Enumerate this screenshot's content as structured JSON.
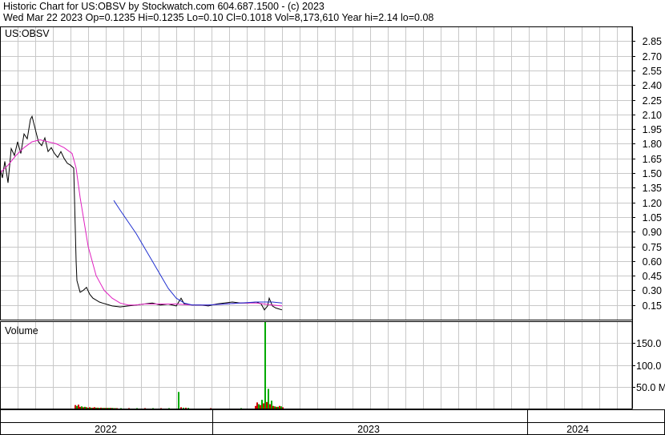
{
  "header": {
    "title_line": "Historic Chart for US:OBSV by Stockwatch.com 604.687.1500 - (c) 2023",
    "quote_line": "Wed Mar 22 2023   Op=0.1235   Hi=0.1235   Lo=0.10   Cl=0.1018   Vol=8,173,610   Year hi=2.14   lo=0.08"
  },
  "colors": {
    "price": "#000000",
    "ma_short": "#e020c0",
    "ma_long": "#2030d0",
    "vol_up": "#00aa00",
    "vol_down": "#cc0000",
    "grid": "#c8c8c8"
  },
  "chart_data": [
    {
      "type": "line",
      "panel_label": "US:OBSV",
      "ylim": [
        0.0,
        3.0
      ],
      "y_ticks": [
        "2.85",
        "2.70",
        "2.55",
        "2.40",
        "2.25",
        "2.10",
        "1.95",
        "1.80",
        "1.65",
        "1.50",
        "1.35",
        "1.20",
        "1.05",
        "0.90",
        "0.75",
        "0.60",
        "0.45",
        "0.30",
        "0.15"
      ],
      "x_labels": [
        "2022",
        "2023",
        "2024"
      ],
      "series": [
        {
          "key": "price",
          "x": [
            0,
            3,
            6,
            10,
            14,
            18,
            22,
            26,
            30,
            34,
            38,
            40,
            44,
            48,
            52,
            56,
            60,
            64,
            68,
            72,
            76,
            80,
            84,
            88,
            92,
            95,
            96,
            100,
            104,
            108,
            112,
            116,
            120,
            124,
            128,
            132,
            140,
            150,
            160,
            170,
            180,
            190,
            200,
            210,
            220,
            226,
            230,
            240,
            250,
            260,
            270,
            280,
            290,
            300,
            310,
            320,
            326,
            330,
            334,
            336,
            340,
            344,
            348,
            352
          ],
          "values": [
            1.55,
            1.45,
            1.62,
            1.4,
            1.75,
            1.68,
            1.82,
            1.7,
            1.9,
            1.85,
            2.05,
            2.08,
            1.95,
            1.82,
            1.78,
            1.86,
            1.72,
            1.76,
            1.7,
            1.66,
            1.72,
            1.65,
            1.6,
            1.58,
            1.55,
            0.6,
            0.4,
            0.28,
            0.3,
            0.33,
            0.26,
            0.22,
            0.2,
            0.18,
            0.17,
            0.16,
            0.14,
            0.13,
            0.14,
            0.15,
            0.16,
            0.17,
            0.15,
            0.16,
            0.14,
            0.22,
            0.16,
            0.15,
            0.15,
            0.14,
            0.16,
            0.17,
            0.18,
            0.17,
            0.17,
            0.18,
            0.16,
            0.1,
            0.14,
            0.22,
            0.14,
            0.12,
            0.11,
            0.1
          ]
        },
        {
          "key": "ma_short",
          "x": [
            0,
            10,
            20,
            30,
            40,
            50,
            60,
            70,
            80,
            90,
            95,
            100,
            110,
            120,
            130,
            140,
            150,
            160,
            170,
            180,
            190,
            200,
            220,
            240,
            260,
            280,
            300,
            320,
            330,
            340,
            352
          ],
          "values": [
            1.5,
            1.58,
            1.68,
            1.76,
            1.82,
            1.84,
            1.82,
            1.8,
            1.76,
            1.7,
            1.55,
            1.25,
            0.75,
            0.45,
            0.3,
            0.22,
            0.17,
            0.15,
            0.15,
            0.16,
            0.16,
            0.16,
            0.16,
            0.15,
            0.15,
            0.16,
            0.17,
            0.17,
            0.16,
            0.15,
            0.14
          ]
        },
        {
          "key": "ma_long",
          "x": [
            142,
            150,
            160,
            170,
            180,
            190,
            200,
            210,
            220,
            230,
            240,
            260,
            280,
            300,
            320,
            340,
            352
          ],
          "values": [
            1.22,
            1.12,
            1.0,
            0.88,
            0.74,
            0.6,
            0.46,
            0.32,
            0.22,
            0.17,
            0.15,
            0.15,
            0.16,
            0.17,
            0.18,
            0.18,
            0.17
          ]
        }
      ]
    },
    {
      "type": "bar",
      "panel_label": "Volume",
      "y_ticks": [
        "150.0",
        "100.0",
        "50.0 M"
      ],
      "ylim": [
        0,
        200
      ],
      "x": [
        93,
        95,
        97,
        99,
        101,
        103,
        105,
        107,
        109,
        111,
        113,
        115,
        117,
        119,
        121,
        123,
        125,
        127,
        129,
        131,
        133,
        135,
        137,
        139,
        141,
        143,
        145,
        150,
        160,
        170,
        180,
        190,
        200,
        210,
        222,
        225,
        228,
        231,
        234,
        262,
        300,
        318,
        320,
        322,
        324,
        326,
        328,
        330,
        332,
        334,
        336,
        338,
        340,
        342,
        344,
        346,
        348,
        350,
        352
      ],
      "values": [
        8,
        6,
        9,
        4,
        5,
        3,
        4,
        3,
        2,
        3,
        2,
        2,
        3,
        2,
        2,
        1.5,
        2,
        1.5,
        1.5,
        1.5,
        1.5,
        1.5,
        1.5,
        1.5,
        1,
        1,
        1,
        1,
        1,
        1,
        1,
        1,
        1,
        1,
        38,
        3,
        2,
        2,
        1.5,
        1,
        1,
        6,
        14,
        10,
        8,
        20,
        12,
        205,
        15,
        45,
        10,
        18,
        6,
        5,
        4,
        4,
        6,
        5,
        3
      ],
      "colors": [
        "vol_down",
        "vol_up",
        "vol_down",
        "vol_down",
        "vol_up",
        "vol_down",
        "vol_up",
        "vol_down",
        "vol_up",
        "vol_down",
        "vol_up",
        "vol_down",
        "vol_down",
        "vol_up",
        "vol_down",
        "vol_up",
        "vol_down",
        "vol_up",
        "vol_down",
        "vol_up",
        "vol_down",
        "vol_up",
        "vol_down",
        "vol_up",
        "vol_down",
        "vol_up",
        "vol_down",
        "vol_up",
        "vol_down",
        "vol_up",
        "vol_down",
        "vol_up",
        "vol_down",
        "vol_up",
        "vol_up",
        "vol_down",
        "vol_up",
        "vol_down",
        "vol_up",
        "vol_down",
        "vol_up",
        "vol_down",
        "vol_down",
        "vol_up",
        "vol_down",
        "vol_up",
        "vol_down",
        "vol_up",
        "vol_down",
        "vol_up",
        "vol_down",
        "vol_up",
        "vol_down",
        "vol_up",
        "vol_down",
        "vol_up",
        "vol_down",
        "vol_up",
        "vol_down"
      ]
    }
  ]
}
